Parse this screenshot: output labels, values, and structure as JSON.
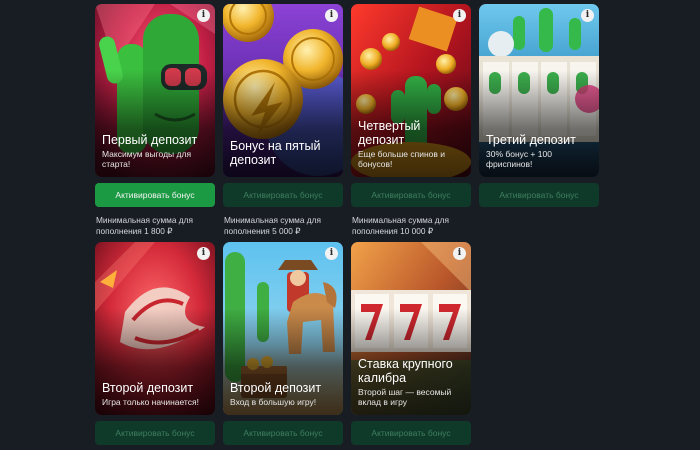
{
  "colors": {
    "background": "#181d24",
    "button_active": "#1b9a43",
    "button_inactive": "#0f3a29",
    "button_inactive_text": "#3f7f5f"
  },
  "cards": [
    {
      "title": "Первый депозит",
      "subtitle": "Максимум выгоды для старта!",
      "button": "Активировать бонус",
      "button_state": "active",
      "min_note": "Минимальная сумма для пополнения 1 800 ₽"
    },
    {
      "title": "Бонус на пятый депозит",
      "subtitle": "",
      "button": "Активировать бонус",
      "button_state": "inactive",
      "min_note": "Минимальная сумма для пополнения 5 000 ₽"
    },
    {
      "title": "Четвертый депозит",
      "subtitle": "Еще больше спинов и бонусов!",
      "button": "Активировать бонус",
      "button_state": "inactive",
      "min_note": "Минимальная сумма для пополнения 10 000 ₽"
    },
    {
      "title": "Третий депозит",
      "subtitle": "30% бонус + 100 фриспинов!",
      "button": "Активировать бонус",
      "button_state": "inactive",
      "min_note": ""
    },
    {
      "title": "Второй депозит",
      "subtitle": "Игра только начинается!",
      "button": "Активировать бонус",
      "button_state": "inactive",
      "min_note": ""
    },
    {
      "title": "Второй депозит",
      "subtitle": "Вход в большую игру!",
      "button": "Активировать бонус",
      "button_state": "inactive",
      "min_note": ""
    },
    {
      "title": "Ставка крупного калибра",
      "subtitle": "Второй шаг — весомый вклад в игру",
      "button": "Активировать бонус",
      "button_state": "inactive",
      "min_note": ""
    }
  ],
  "info_glyph": "i",
  "info_icon": "info-icon"
}
